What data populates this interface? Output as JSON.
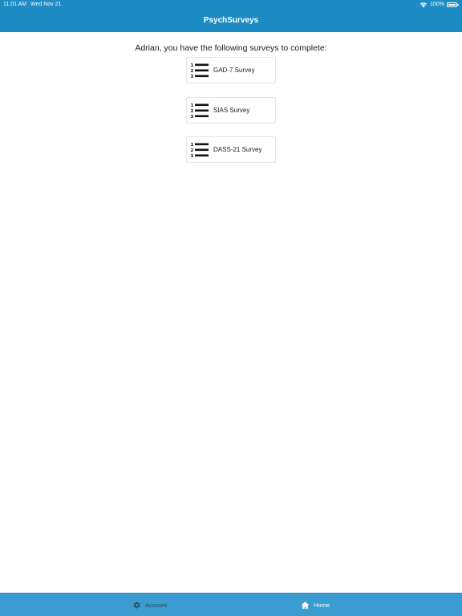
{
  "status_bar": {
    "time": "11:01 AM",
    "date": "Wed Nov 21",
    "battery": "100%",
    "wifi_icon": "wifi-icon",
    "battery_icon": "battery-icon"
  },
  "header": {
    "title": "PsychSurveys",
    "color": "#1d8bc4"
  },
  "main": {
    "prompt": "Adrian, you have the following surveys to complete:",
    "surveys": [
      {
        "label": "GAD-7 Survey",
        "icon": "numbered-list-icon"
      },
      {
        "label": "SIAS Survey",
        "icon": "numbered-list-icon"
      },
      {
        "label": "DASS-21 Survey",
        "icon": "numbered-list-icon"
      }
    ]
  },
  "tabbar": {
    "color": "#3a9cd0",
    "tabs": [
      {
        "label": "Account",
        "icon": "gear-icon",
        "selected": false
      },
      {
        "label": "Home",
        "icon": "home-icon",
        "selected": true
      }
    ]
  }
}
